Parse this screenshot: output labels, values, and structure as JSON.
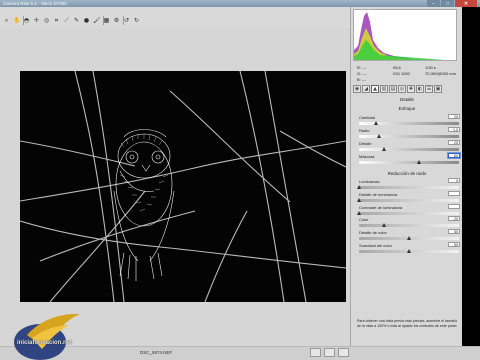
{
  "window": {
    "title": "Camera Raw 5.2 - Nikon D7000",
    "minimize_icon": "minimize-icon",
    "maximize_icon": "maximize-icon",
    "close_icon": "close-icon"
  },
  "toolbar": {
    "tools": [
      "zoom-icon",
      "hand-icon",
      "white-balance-icon",
      "color-sampler-icon",
      "targeted-adjustment-icon",
      "crop-icon",
      "straighten-icon",
      "spot-removal-icon",
      "red-eye-icon",
      "adjustment-brush-icon",
      "graduated-filter-icon",
      "preferences-icon",
      "rotate-left-icon",
      "rotate-right-icon"
    ]
  },
  "readouts": {
    "r": "R:",
    "g": "G:",
    "b": "B:",
    "r_val": "---",
    "g_val": "---",
    "b_val": "---",
    "aperture": "f/5,6",
    "shutter": "1/30 s",
    "iso": "ISO 1000",
    "lens": "70-300@300 mm"
  },
  "panel": {
    "tab_title": "Detalle",
    "sharpening": {
      "title": "Enfoque",
      "controls": [
        {
          "label": "Cantidad",
          "value": "25",
          "level": 0.17
        },
        {
          "label": "Radio",
          "value": "1,0",
          "level": 0.2
        },
        {
          "label": "Detalle",
          "value": "25",
          "level": 0.25
        },
        {
          "label": "Máscara",
          "value": "60",
          "level": 0.6
        }
      ]
    },
    "noise": {
      "title": "Reducción de ruido",
      "controls": [
        {
          "label": "Luminancia",
          "value": "0",
          "level": 0.0
        },
        {
          "label": "Detalle de luminancia",
          "value": "",
          "level": 0.0
        },
        {
          "label": "Contraste de luminancia",
          "value": "",
          "level": 0.0
        },
        {
          "label": "Color",
          "value": "25",
          "level": 0.25
        },
        {
          "label": "Detalle de color",
          "value": "50",
          "level": 0.5
        },
        {
          "label": "Suavidad del color",
          "value": "50",
          "level": 0.5
        }
      ]
    },
    "help": "Para obtener una vista previa más precisa, aumente el tamaño de la vista a 100% o más al ajustar los controles de este panel."
  },
  "image": {
    "filename": "DSC_5974.NEF"
  },
  "logo": {
    "text": "iniciaformacion.net"
  },
  "colors": {
    "app_bg": "#d6d6d6",
    "titlebar": "#8aa3b8",
    "accent_blue": "#2f62c9",
    "close_red": "#c9463d"
  }
}
